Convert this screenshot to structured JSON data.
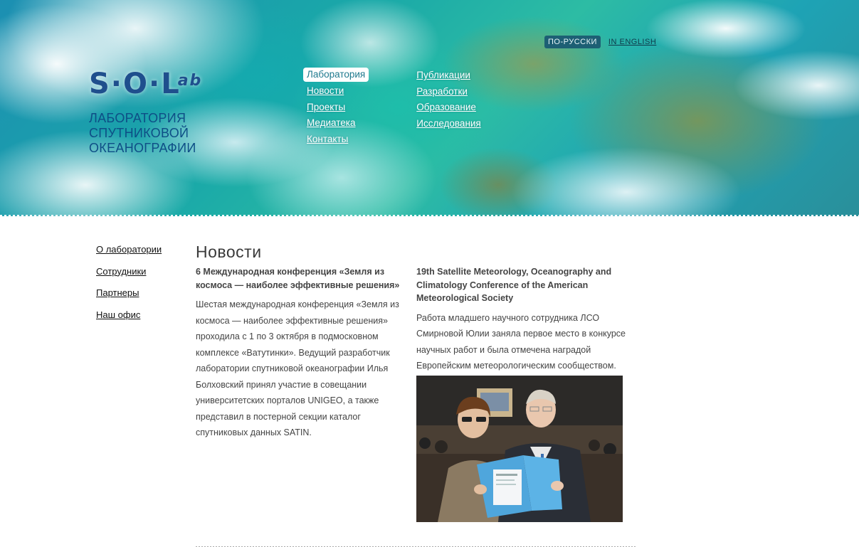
{
  "header": {
    "logo_mark": "S·O·L",
    "logo_suffix": "ab",
    "logo_text": "Лаборатория спутниковой океанографии",
    "lang": {
      "current": "По-русски",
      "other": "In English"
    },
    "nav_col1": [
      "Лаборатория",
      "Новости",
      "Проекты",
      "Медиатека",
      "Контакты"
    ],
    "nav_col2": [
      "Публикации",
      "Разработки",
      "Образование",
      "Исследования"
    ]
  },
  "sidebar": {
    "items": [
      "О лаборатории",
      "Сотрудники",
      "Партнеры",
      "Наш офис"
    ]
  },
  "main": {
    "title": "Новости",
    "news": [
      {
        "title": "6 Международная конференция «Земля из космоса — наиболее эффективные решения»",
        "text": "Шестая международная конференция «Земля из космоса — наиболее эффективные решения» проходила с 1 по 3 октября в подмосковном комплексе «Ватутинки». Ведущий разработчик лаборатории спутниковой океанографии Илья Болховский принял участие в совещании университетских порталов UNIGEO, а также представил в постерной секции каталог спутниковых данных SATIN."
      },
      {
        "title": "19th Satellite Meteorology, Oceanography and Climatology Conference of the American Meteorological Society",
        "text": "Работа младшего научного сотрудника ЛСО Смирновой Юлии заняла первое место в конкурсе научных работ и была отмечена наградой Европейским метеорологическим сообществом."
      }
    ]
  },
  "colors": {
    "accent": "#1f7a8e",
    "logo_blue": "#0e4e86",
    "lang_active_bg": "#1d5f74"
  }
}
